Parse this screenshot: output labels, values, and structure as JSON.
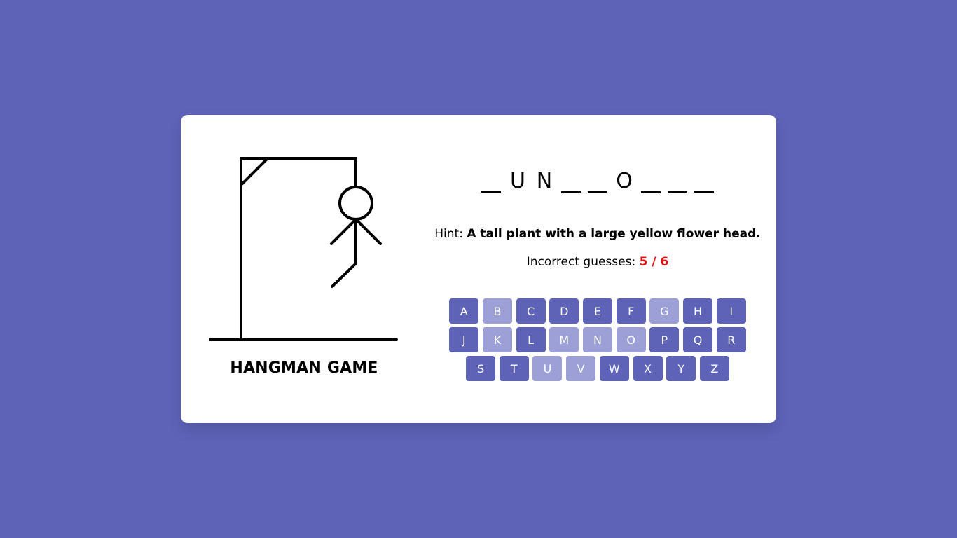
{
  "title": "HANGMAN GAME",
  "word": [
    "",
    "U",
    "N",
    "",
    "",
    "O",
    "",
    "",
    ""
  ],
  "hint": {
    "label": "Hint:",
    "text": "A tall plant with a large yellow flower head."
  },
  "guesses": {
    "label": "Incorrect guesses:",
    "count": "5 / 6"
  },
  "keyboard": {
    "rows": [
      [
        {
          "letter": "A",
          "used": false
        },
        {
          "letter": "B",
          "used": true
        },
        {
          "letter": "C",
          "used": false
        },
        {
          "letter": "D",
          "used": false
        },
        {
          "letter": "E",
          "used": false
        },
        {
          "letter": "F",
          "used": false
        },
        {
          "letter": "G",
          "used": true
        },
        {
          "letter": "H",
          "used": false
        },
        {
          "letter": "I",
          "used": false
        }
      ],
      [
        {
          "letter": "J",
          "used": false
        },
        {
          "letter": "K",
          "used": true
        },
        {
          "letter": "L",
          "used": false
        },
        {
          "letter": "M",
          "used": true
        },
        {
          "letter": "N",
          "used": true
        },
        {
          "letter": "O",
          "used": true
        },
        {
          "letter": "P",
          "used": false
        },
        {
          "letter": "Q",
          "used": false
        },
        {
          "letter": "R",
          "used": false
        }
      ],
      [
        {
          "letter": "S",
          "used": false
        },
        {
          "letter": "T",
          "used": false
        },
        {
          "letter": "U",
          "used": true
        },
        {
          "letter": "V",
          "used": true
        },
        {
          "letter": "W",
          "used": false
        },
        {
          "letter": "X",
          "used": false
        },
        {
          "letter": "Y",
          "used": false
        },
        {
          "letter": "Z",
          "used": false
        }
      ]
    ]
  },
  "colors": {
    "background": "#5e63b8",
    "key": "#5e63b8",
    "key_used": "#9da0d6",
    "incorrect": "#e31010"
  }
}
